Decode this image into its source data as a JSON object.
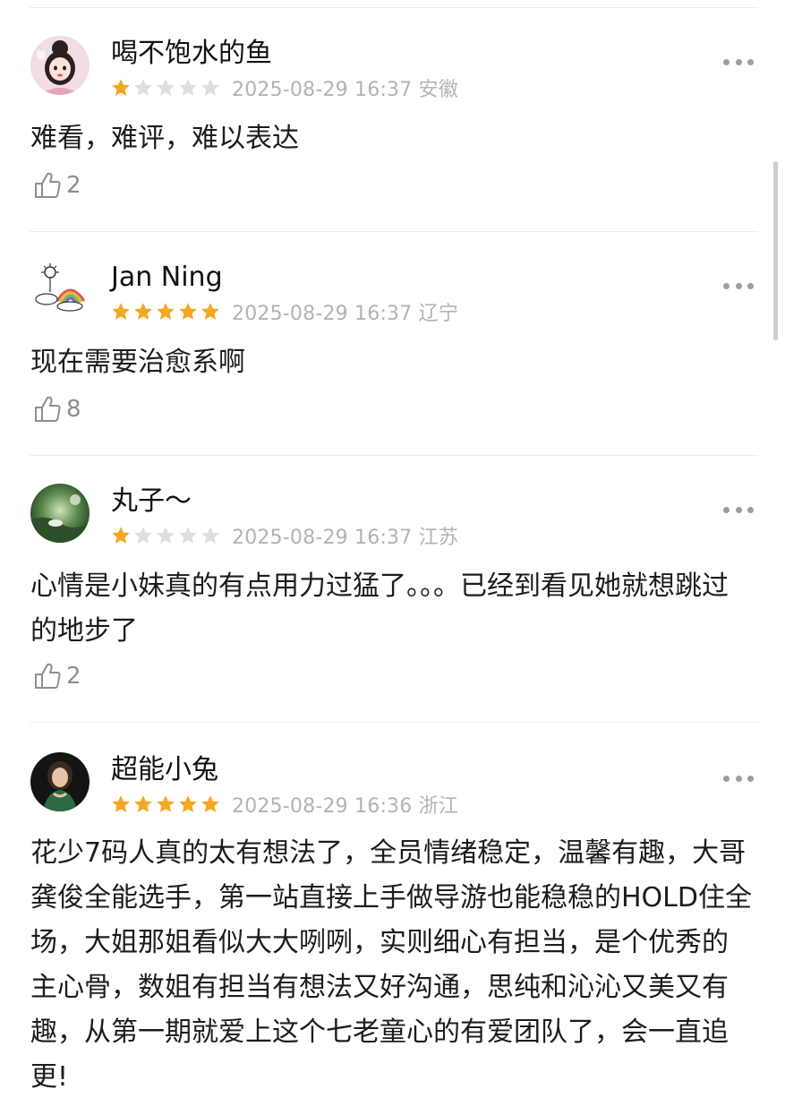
{
  "comments": [
    {
      "username": "喝不饱水的鱼",
      "rating": 1,
      "meta": "2025-08-29 16:37 安徽",
      "text": "难看，难评，难以表达",
      "likes": "2"
    },
    {
      "username": "Jan Ning",
      "rating": 5,
      "meta": "2025-08-29 16:37 辽宁",
      "text": "现在需要治愈系啊",
      "likes": "8"
    },
    {
      "username": "丸子～",
      "rating": 1,
      "meta": "2025-08-29 16:37 江苏",
      "text": "心情是小妹真的有点用力过猛了。。。已经到看见她就想跳过的地步了",
      "likes": "2"
    },
    {
      "username": "超能小兔",
      "rating": 5,
      "meta": "2025-08-29 16:36 浙江",
      "text": "花少7码人真的太有想法了，全员情绪稳定，温馨有趣，大哥龚俊全能选手，第一站直接上手做导游也能稳稳的HOLD住全场，大姐那姐看似大大咧咧，实则细心有担当，是个优秀的主心骨，数姐有担当有想法又好沟通，思纯和沁沁又美又有趣，从第一期就爱上这个七老童心的有爱团队了，会一直追更!"
    }
  ],
  "rating_max": 5,
  "colors": {
    "star_filled": "#f5a623",
    "star_empty": "#dedede",
    "meta_text": "#b3b3b3",
    "divider": "#ececec"
  },
  "icons": {
    "like": "thumbs-up-icon",
    "more": "more-dots-icon"
  }
}
